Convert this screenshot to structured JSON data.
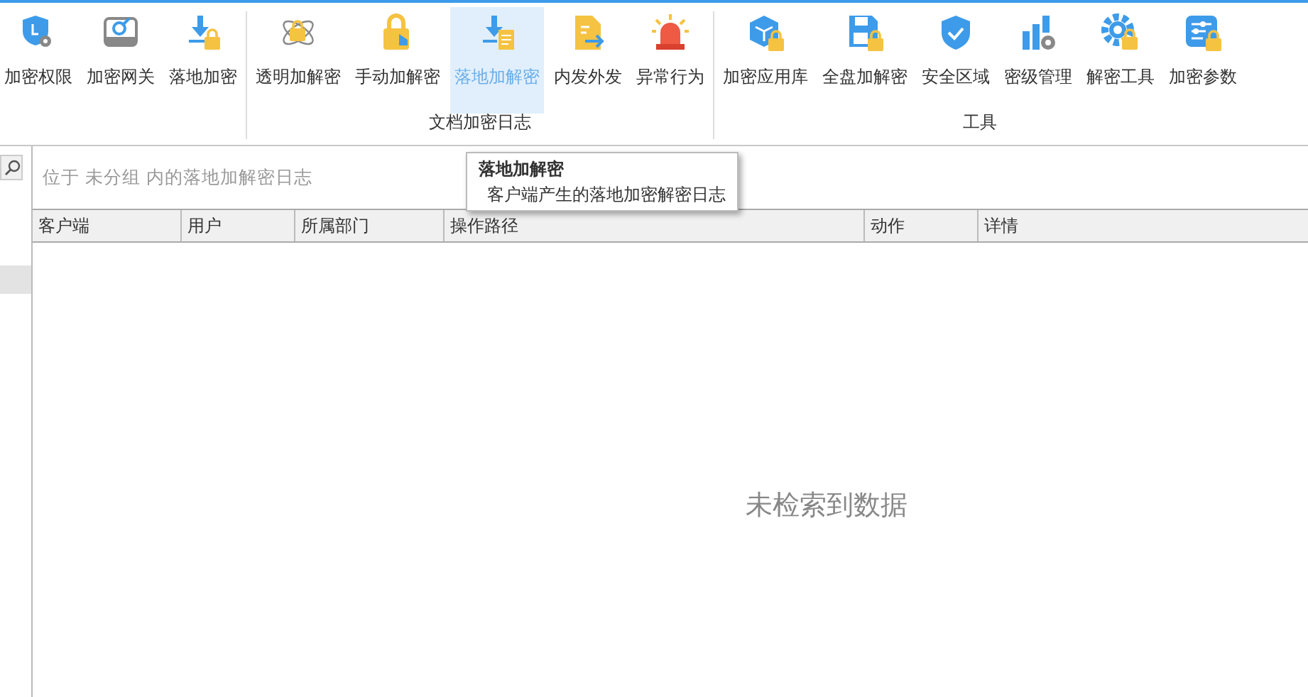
{
  "ribbon": {
    "groups": [
      {
        "buttons": [
          {
            "label": "加密权限",
            "selected": false
          },
          {
            "label": "加密网关",
            "selected": false
          },
          {
            "label": "落地加密",
            "selected": false
          }
        ]
      },
      {
        "label": "文档加密日志",
        "buttons": [
          {
            "label": "透明加解密",
            "selected": false
          },
          {
            "label": "手动加解密",
            "selected": false
          },
          {
            "label": "落地加解密",
            "selected": true
          },
          {
            "label": "内发外发",
            "selected": false
          },
          {
            "label": "异常行为",
            "selected": false
          }
        ]
      },
      {
        "label": "工具",
        "buttons": [
          {
            "label": "加密应用库",
            "selected": false
          },
          {
            "label": "全盘加解密",
            "selected": false
          },
          {
            "label": "安全区域",
            "selected": false
          },
          {
            "label": "密级管理",
            "selected": false
          },
          {
            "label": "解密工具",
            "selected": false
          },
          {
            "label": "加密参数",
            "selected": false
          }
        ]
      }
    ]
  },
  "tooltip": {
    "title": "落地加解密",
    "description": "客户端产生的落地加密解密日志"
  },
  "location_text": "位于 未分组 内的落地加解密日志",
  "table": {
    "columns": [
      "客户端",
      "用户",
      "所属部门",
      "操作路径",
      "动作",
      "详情"
    ],
    "empty_message": "未检索到数据"
  }
}
